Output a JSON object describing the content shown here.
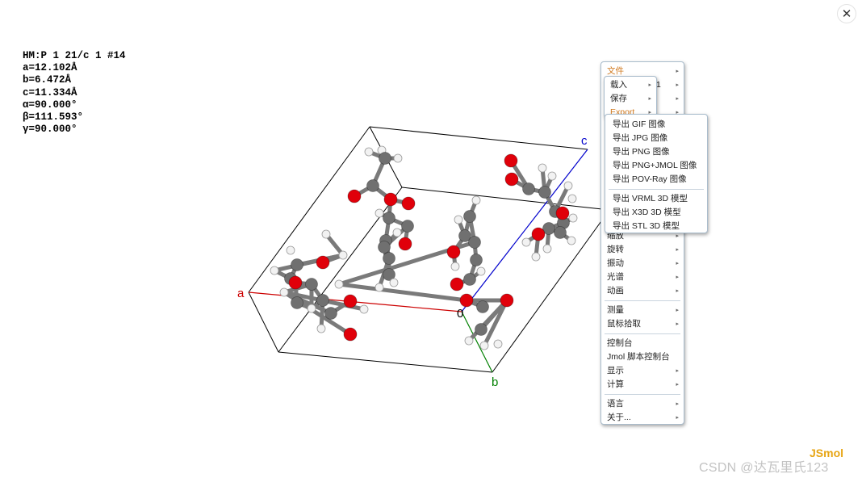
{
  "window": {
    "close_symbol": "✕"
  },
  "cell_info": [
    "HM:P 1 21/c 1 #14",
    "a=12.102Å",
    "b=6.472Å",
    "c=11.334Å",
    "α=90.000°",
    "β=111.593°",
    "γ=90.000°"
  ],
  "axes": {
    "a": "a",
    "b": "b",
    "c": "c",
    "origin": "0"
  },
  "colors": {
    "axis_a": "#cc0000",
    "axis_b": "#008000",
    "axis_c": "#0000cc",
    "carbon": "#707070",
    "oxygen": "#e0000a",
    "hydrogen": "#f2f2f2",
    "menu_orange": "#d0791f",
    "brand": "#e7a514"
  },
  "main_menu": {
    "file": "文件",
    "partial_obscured": "1",
    "zoom": "缩放",
    "rotate": "旋转",
    "vibrate": "振动",
    "spectra": "光谱",
    "animation": "动画",
    "measure": "测量",
    "pick": "鼠标拾取",
    "console": "控制台",
    "script_console": "Jmol 脚本控制台",
    "display": "显示",
    "compute": "计算",
    "language": "语言",
    "about": "关于..."
  },
  "file_menu": {
    "load": "载入",
    "save": "保存",
    "export": "Export"
  },
  "export_menu": [
    "导出 GIF 图像",
    "导出 JPG 图像",
    "导出 PNG 图像",
    "导出 PNG+JMOL 图像",
    "导出 POV-Ray 图像",
    "导出 VRML 3D 模型",
    "导出 X3D 3D 模型",
    "导出 STL 3D 模型"
  ],
  "brand": "JSmol",
  "watermark": "CSDN @达瓦里氏123"
}
